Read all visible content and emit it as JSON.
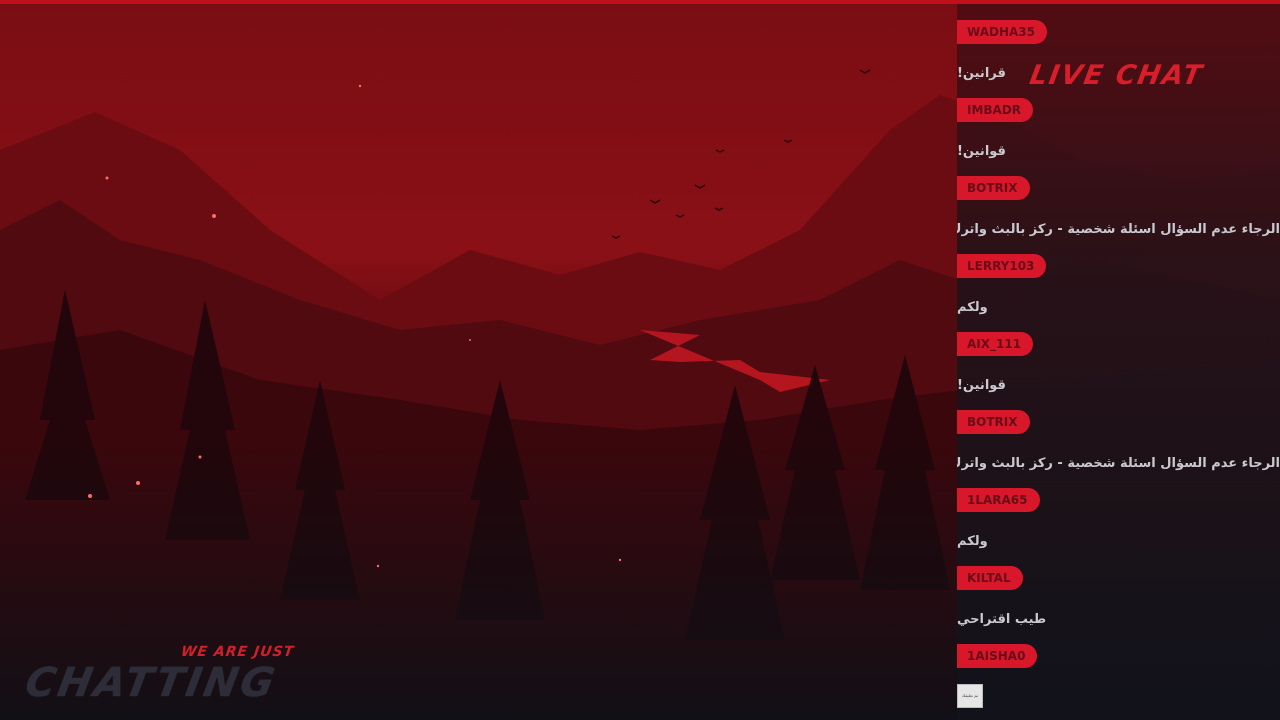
{
  "branding": {
    "tagline": "WE ARE JUST",
    "title": "CHATTING",
    "chat_title": "LIVE CHAT"
  },
  "colors": {
    "accent": "#d8182a",
    "sky_top": "#8a0f16",
    "sky_bottom": "#5a0b10",
    "panel_bg": "#12131b",
    "message_text": "#c9c9cf"
  },
  "chat": {
    "messages": [
      {
        "user": "WADHA35",
        "text": "قرانين!"
      },
      {
        "user": "IMBADR",
        "text": "قوانين!"
      },
      {
        "user": "BOTRIX",
        "text": "الرجاء عدم السؤال اسئلة شخصية - ركز بالبث واترك المواضيع الجانبيه"
      },
      {
        "user": "LERRY103",
        "text": "ولكم"
      },
      {
        "user": "AIX_111",
        "text": "قوانين!"
      },
      {
        "user": "BOTRIX",
        "text": "الرجاء عدم السؤال اسئلة شخصية - ركز بالبث واترك المواضيع الجانبيه"
      },
      {
        "user": "1LARA65",
        "text": "ولكم"
      },
      {
        "user": "KILTAL",
        "text": "طيب اقتراحي"
      },
      {
        "user": "1AISHA0",
        "text": ""
      }
    ],
    "last_attachment": "تم تعليقك"
  }
}
